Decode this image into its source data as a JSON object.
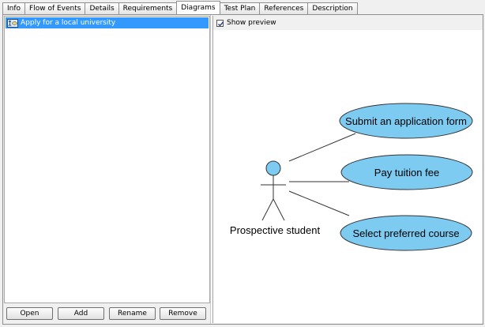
{
  "tabs": [
    {
      "label": "Info"
    },
    {
      "label": "Flow of Events"
    },
    {
      "label": "Details"
    },
    {
      "label": "Requirements"
    },
    {
      "label": "Diagrams",
      "active": true
    },
    {
      "label": "Test Plan"
    },
    {
      "label": "References"
    },
    {
      "label": "Description"
    }
  ],
  "diagram_list": {
    "items": [
      {
        "label": "Apply for a local university",
        "icon": "use-case-diagram-icon",
        "selected": true
      }
    ]
  },
  "buttons": {
    "open": "Open",
    "add": "Add",
    "rename": "Rename",
    "remove": "Remove"
  },
  "preview": {
    "show_preview_label": "Show preview",
    "checked": true
  },
  "diagram": {
    "actor": "Prospective student",
    "use_cases": [
      "Submit an application form",
      "Pay tuition fee",
      "Select preferred course"
    ],
    "colors": {
      "use_case_fill": "#7ecbf2",
      "actor_head_fill": "#7ecbf2",
      "stroke": "#333333"
    }
  },
  "colors": {
    "selection": "#3399ff",
    "background": "#f0f0f0"
  }
}
